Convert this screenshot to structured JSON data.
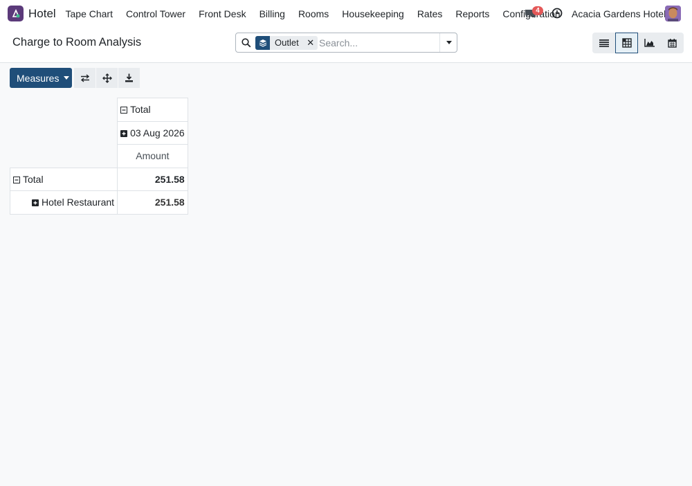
{
  "navbar": {
    "app_name": "Hotel",
    "menu": [
      "Tape Chart",
      "Control Tower",
      "Front Desk",
      "Billing",
      "Rooms",
      "Housekeeping",
      "Rates",
      "Reports",
      "Configuration"
    ],
    "notification_count": "4",
    "company": "Acacia Gardens Hotel"
  },
  "control_panel": {
    "breadcrumb": "Charge to Room Analysis",
    "search": {
      "facet_label": "Outlet",
      "facet_remove": "✕",
      "placeholder": "Search..."
    },
    "views": [
      {
        "name": "list",
        "icon": "list-icon",
        "active": false
      },
      {
        "name": "pivot",
        "icon": "pivot-icon",
        "active": true
      },
      {
        "name": "graph",
        "icon": "area-chart-icon",
        "active": false
      },
      {
        "name": "calendar",
        "icon": "calendar-icon",
        "active": false
      }
    ]
  },
  "toolbar": {
    "measures_label": "Measures",
    "tools": [
      "flip-axis-icon",
      "expand-all-icon",
      "download-icon"
    ]
  },
  "pivot": {
    "col_header_total": "Total",
    "col_header_date": "03 Aug 2026",
    "measure_header": "Amount",
    "rows": [
      {
        "label": "Total",
        "value": "251.58"
      },
      {
        "label": "Hotel Restaurant",
        "value": "251.58"
      }
    ]
  },
  "colors": {
    "primary": "#1f4e79",
    "badge": "#e45858",
    "brand": "#5b3a7a"
  }
}
